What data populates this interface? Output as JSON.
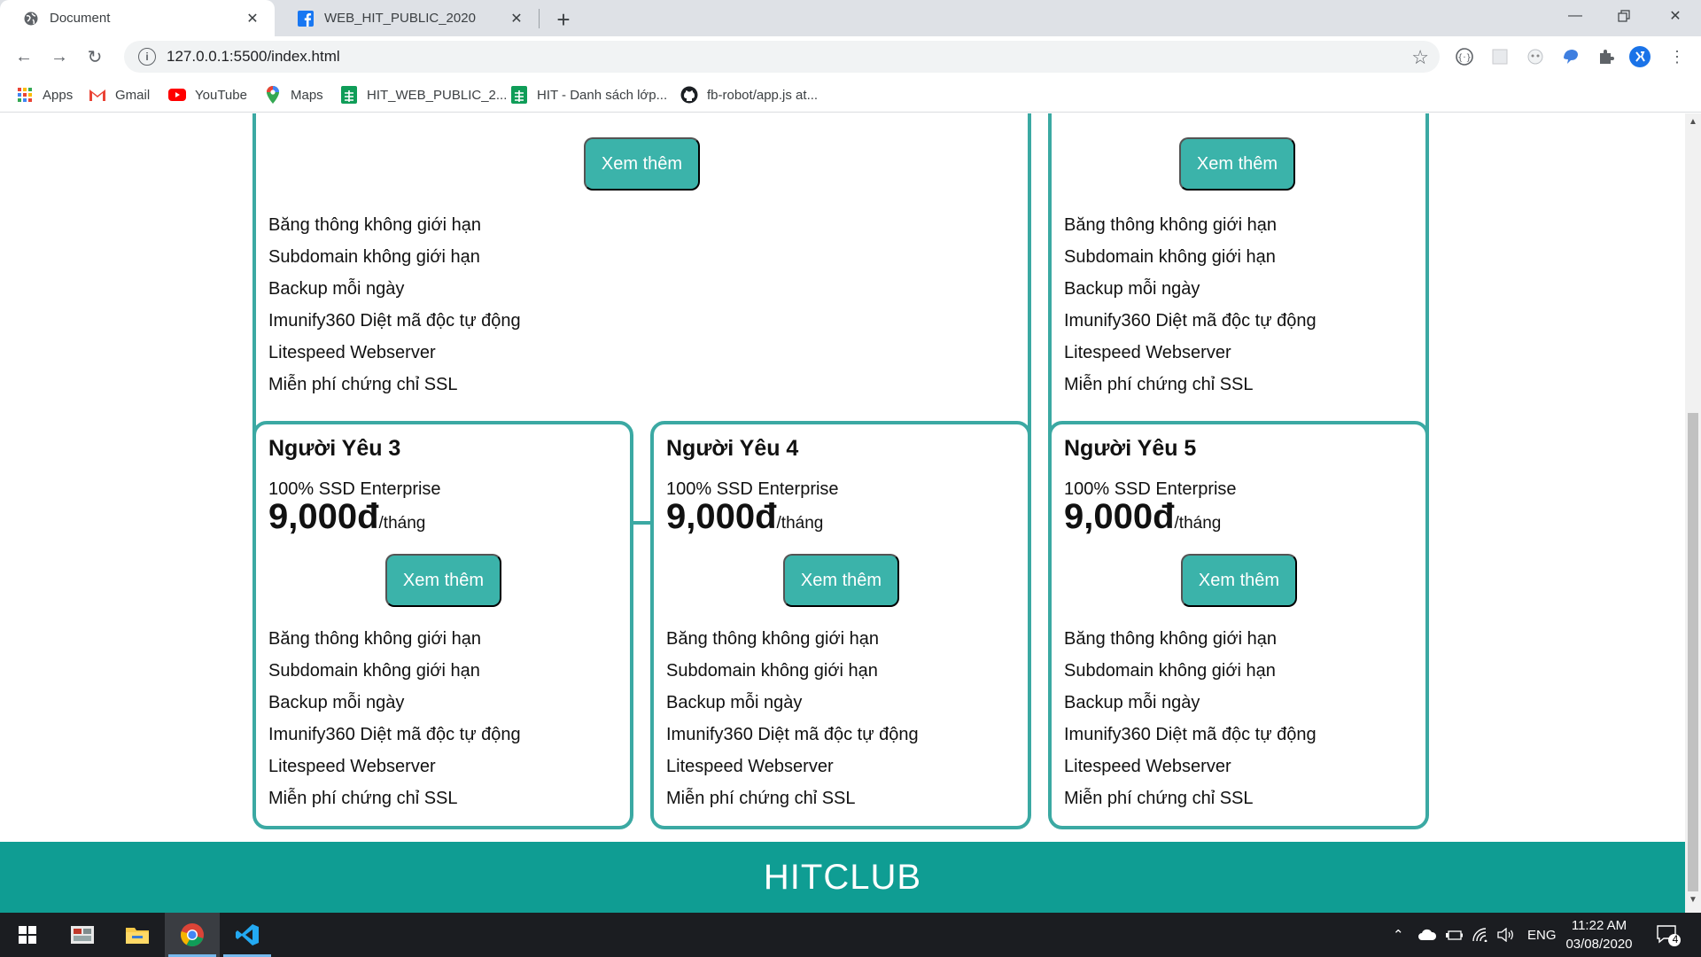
{
  "browser": {
    "tabs": [
      {
        "title": "Document",
        "icon": "globe-icon"
      },
      {
        "title": "WEB_HIT_PUBLIC_2020",
        "icon": "facebook-icon"
      }
    ],
    "new_tab": "+",
    "url": "127.0.0.1:5500/index.html",
    "bookmarks": [
      {
        "label": "Apps"
      },
      {
        "label": "Gmail"
      },
      {
        "label": "YouTube"
      },
      {
        "label": "Maps"
      },
      {
        "label": "HIT_WEB_PUBLIC_2..."
      },
      {
        "label": "HIT - Danh sách lớp..."
      },
      {
        "label": "fb-robot/app.js at..."
      }
    ]
  },
  "page": {
    "more_label": "Xem thêm",
    "features": [
      "Băng thông không giới hạn",
      "Subdomain không giới hạn",
      "Backup mỗi ngày",
      "Imunify360 Diệt mã độc tự động",
      "Litespeed Webserver",
      "Miễn phí chứng chỉ SSL"
    ],
    "plans": [
      {
        "title": "Người Yêu 3",
        "storage": "100% SSD Enterprise",
        "price": "9,000đ",
        "unit": "/tháng"
      },
      {
        "title": "Người Yêu 4",
        "storage": "100% SSD Enterprise",
        "price": "9,000đ",
        "unit": "/tháng"
      },
      {
        "title": "Người Yêu 5",
        "storage": "100% SSD Enterprise",
        "price": "9,000đ",
        "unit": "/tháng"
      }
    ],
    "footer": "HITCLUB",
    "accent_color": "#3bb3aa",
    "footer_color": "#0f9d93"
  },
  "taskbar": {
    "language": "ENG",
    "time": "11:22 AM",
    "date": "03/08/2020",
    "notifications": "4"
  }
}
